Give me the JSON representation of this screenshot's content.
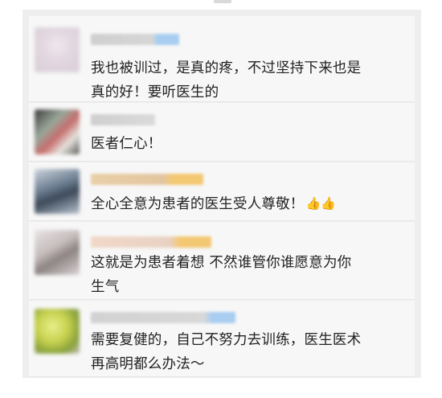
{
  "comments": [
    {
      "text_lines": [
        "我也被训过，是真的疼，不过坚持下来也是",
        "真的好！要听医生的"
      ]
    },
    {
      "text_lines": [
        "医者仁心！"
      ]
    },
    {
      "text_lines": [
        "全心全意为患者的医生受人尊敬！"
      ],
      "emoji": "👍👍"
    },
    {
      "text_lines": [
        "这就是为患者着想 不然谁管你谁愿意为你",
        "生气"
      ]
    },
    {
      "text_lines": [
        "需要复健的，自己不努力去训练，医生医术",
        "再高明都么办法～"
      ]
    }
  ],
  "colors": {
    "background": "#ffffff",
    "feed_background": "#eeeeee",
    "card_background": "#f7f7f7",
    "text": "#222222",
    "blurred_accent_blue": "#a8cdf0",
    "blurred_accent_yellow": "#f3c872"
  },
  "icons": [
    "thumbs-up-emoji"
  ]
}
